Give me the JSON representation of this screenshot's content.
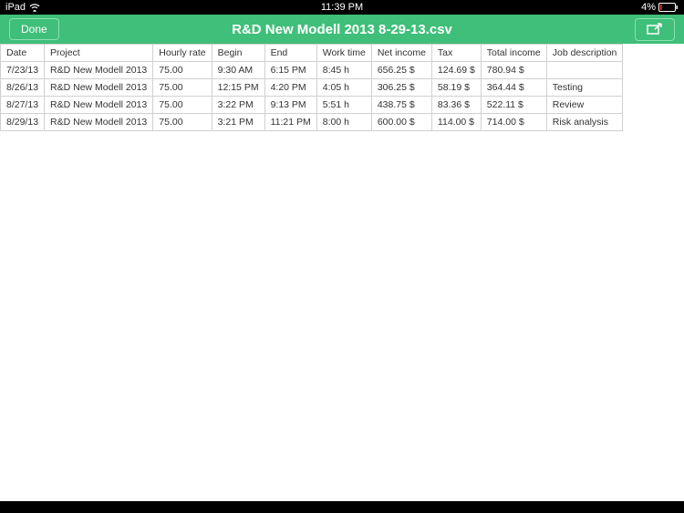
{
  "statusBar": {
    "device": "iPad",
    "time": "11:39 PM",
    "battery": "4%"
  },
  "navBar": {
    "doneLabel": "Done",
    "title": "R&D New Modell 2013 8-29-13.csv"
  },
  "table": {
    "headers": [
      "Date",
      "Project",
      "Hourly rate",
      "Begin",
      "End",
      "Work time",
      "Net income",
      "Tax",
      "Total income",
      "Job description"
    ],
    "rows": [
      [
        "7/23/13",
        "R&D New Modell 2013",
        "75.00",
        "9:30 AM",
        "6:15 PM",
        "8:45 h",
        "656.25 $",
        "124.69 $",
        "780.94 $",
        ""
      ],
      [
        "8/26/13",
        "R&D New Modell 2013",
        "75.00",
        "12:15 PM",
        "4:20 PM",
        "4:05 h",
        "306.25 $",
        "58.19 $",
        "364.44 $",
        "Testing"
      ],
      [
        "8/27/13",
        "R&D New Modell 2013",
        "75.00",
        "3:22 PM",
        "9:13 PM",
        "5:51 h",
        "438.75 $",
        "83.36 $",
        "522.11 $",
        "Review"
      ],
      [
        "8/29/13",
        "R&D New Modell 2013",
        "75.00",
        "3:21 PM",
        "11:21 PM",
        "8:00 h",
        "600.00 $",
        "114.00 $",
        "714.00 $",
        "Risk analysis"
      ]
    ]
  }
}
